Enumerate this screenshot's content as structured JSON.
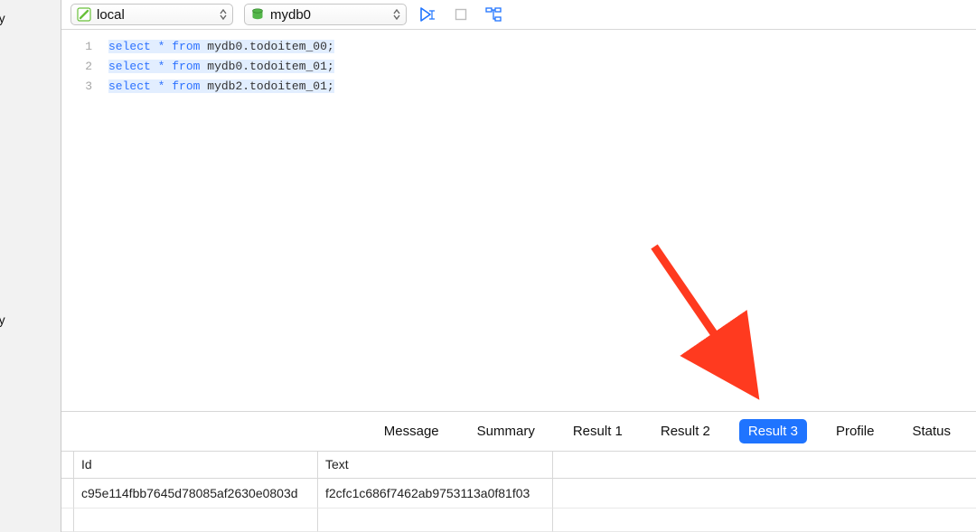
{
  "sidebar": {
    "label1": "ry",
    "label2": "ry"
  },
  "toolbar": {
    "connection": {
      "icon": "connection-icon",
      "label": "local"
    },
    "database": {
      "icon": "database-icon",
      "label": "mydb0"
    },
    "run_icon": "run-cursor-icon",
    "stop_icon": "stop-icon",
    "explain_icon": "explain-tree-icon"
  },
  "editor": {
    "lines": [
      {
        "n": "1",
        "kw1": "select",
        "star": "*",
        "kw2": "from",
        "rest": "mydb0.todoitem_00;"
      },
      {
        "n": "2",
        "kw1": "select",
        "star": "*",
        "kw2": "from",
        "rest": "mydb0.todoitem_01;"
      },
      {
        "n": "3",
        "kw1": "select",
        "star": "*",
        "kw2": "from",
        "rest": "mydb2.todoitem_01;"
      }
    ]
  },
  "tabs": {
    "message": "Message",
    "summary": "Summary",
    "r1": "Result 1",
    "r2": "Result 2",
    "r3": "Result 3",
    "profile": "Profile",
    "status": "Status",
    "active": "r3"
  },
  "results": {
    "columns": {
      "id": "Id",
      "text": "Text"
    },
    "rows": [
      {
        "id": "c95e114fbb7645d78085af2630e0803d",
        "text": "f2cfc1c686f7462ab9753113a0f81f03"
      }
    ]
  },
  "annotation": {
    "arrow_color": "#ff3a1f"
  }
}
